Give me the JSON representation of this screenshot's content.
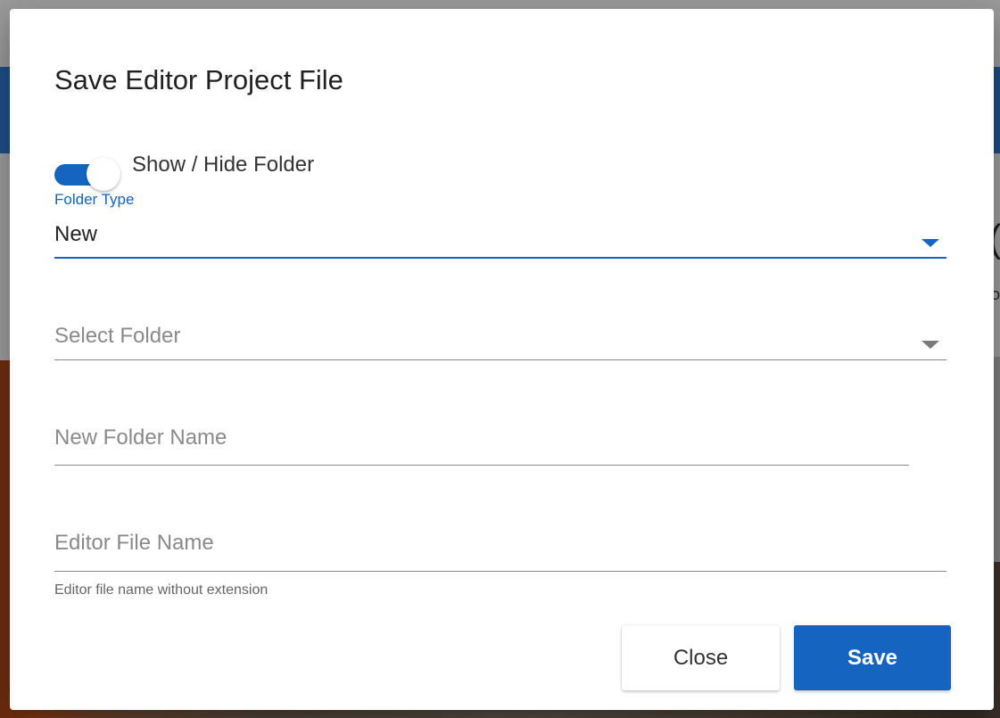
{
  "background": {
    "glyph_large": "(",
    "glyph_small": "o"
  },
  "dialog": {
    "title": "Save Editor Project File",
    "toggle": {
      "label": "Show / Hide Folder",
      "on": true
    },
    "folder_type": {
      "label": "Folder Type",
      "value": "New"
    },
    "select_folder": {
      "placeholder": "Select Folder"
    },
    "new_folder_name": {
      "placeholder": "New Folder Name"
    },
    "editor_file_name": {
      "placeholder": "Editor File Name",
      "hint": "Editor file name without extension"
    },
    "buttons": {
      "close": "Close",
      "save": "Save"
    }
  },
  "colors": {
    "primary": "#1565c0",
    "text": "#212121",
    "placeholder": "#8a8a8a"
  },
  "icons": {
    "select_caret": "caret-down-icon"
  }
}
